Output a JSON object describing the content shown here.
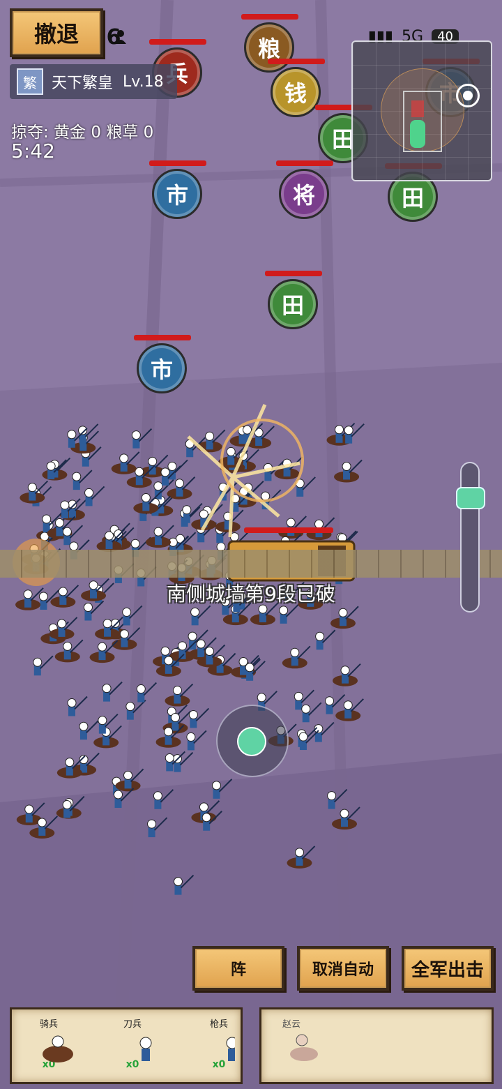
{
  "status": {
    "time": "16:16",
    "network": "5G",
    "battery": "40"
  },
  "retreat_label": "撤退",
  "player": {
    "badge": "繁",
    "name": "天下繁皇",
    "level": "Lv.18"
  },
  "loot": {
    "text": "掠夺: 黄金 0  粮草 0"
  },
  "timer": "5:42",
  "buildings": [
    {
      "label": "兵",
      "color": "#9e2a1e"
    },
    {
      "label": "粮",
      "color": "#8a5a22"
    },
    {
      "label": "钱",
      "color": "#b8942a"
    },
    {
      "label": "田",
      "color": "#3f8a3a"
    },
    {
      "label": "市",
      "color": "#2f6ea0"
    },
    {
      "label": "将",
      "color": "#7a3d8c"
    },
    {
      "label": "田",
      "color": "#3f8a3a"
    },
    {
      "label": "田",
      "color": "#3f8a3a"
    },
    {
      "label": "市",
      "color": "#2f6ea0"
    },
    {
      "label": "市",
      "color": "#2f6ea0"
    }
  ],
  "wall_message": "南侧城墙第9段已破",
  "actions": {
    "formation": "阵",
    "cancel_auto": "取消自动",
    "all_attack": "全军出击"
  },
  "units": [
    {
      "name": "骑兵",
      "count": "x0"
    },
    {
      "name": "刀兵",
      "count": "x0"
    },
    {
      "name": "枪兵",
      "count": "x0"
    }
  ],
  "hero": {
    "name": "赵云"
  },
  "colors": {
    "accent": "#5fd3a4",
    "hp": "#d11b1b",
    "parchment": "#f0c070"
  }
}
